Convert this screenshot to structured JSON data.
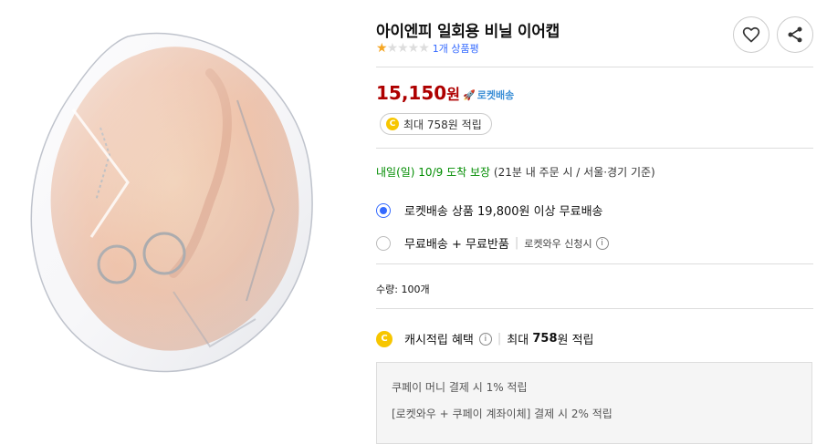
{
  "product": {
    "title": "아이엔피 일회용 비닐 이어캡",
    "rating_stars": 1,
    "review_count": "1개 상품평",
    "price_number": "15,150",
    "price_unit": "원",
    "rocket_label": "로켓배송",
    "cash_pill": "최대 758원 적립"
  },
  "delivery": {
    "date": "내일(일) 10/9",
    "arrive": "도착 보장",
    "note": "(21분  내 주문 시 / 서울⋅경기 기준)"
  },
  "options": [
    {
      "label": "로켓배송 상품 19,800원 이상 무료배송",
      "selected": true
    },
    {
      "label": "무료배송 + 무료반품",
      "sub": "로켓와우 신청시"
    }
  ],
  "quantity": "수량: 100개",
  "cashback": {
    "label": "캐시적립 혜택",
    "max_prefix": "최대",
    "max_amount": "758",
    "max_suffix": "원 적립"
  },
  "cash_details": [
    "쿠페이 머니 결제 시 1% 적립",
    "[로켓와우 + 쿠페이 계좌이체] 결제 시 2% 적립"
  ],
  "icons": {
    "wishlist": "heart-icon",
    "share": "share-icon",
    "coin": "C"
  },
  "colors": {
    "price": "#ae0000",
    "accent": "#346aff",
    "rocket": "#3c8fd6",
    "delivery": "#008c00",
    "star": "#f5a623"
  }
}
